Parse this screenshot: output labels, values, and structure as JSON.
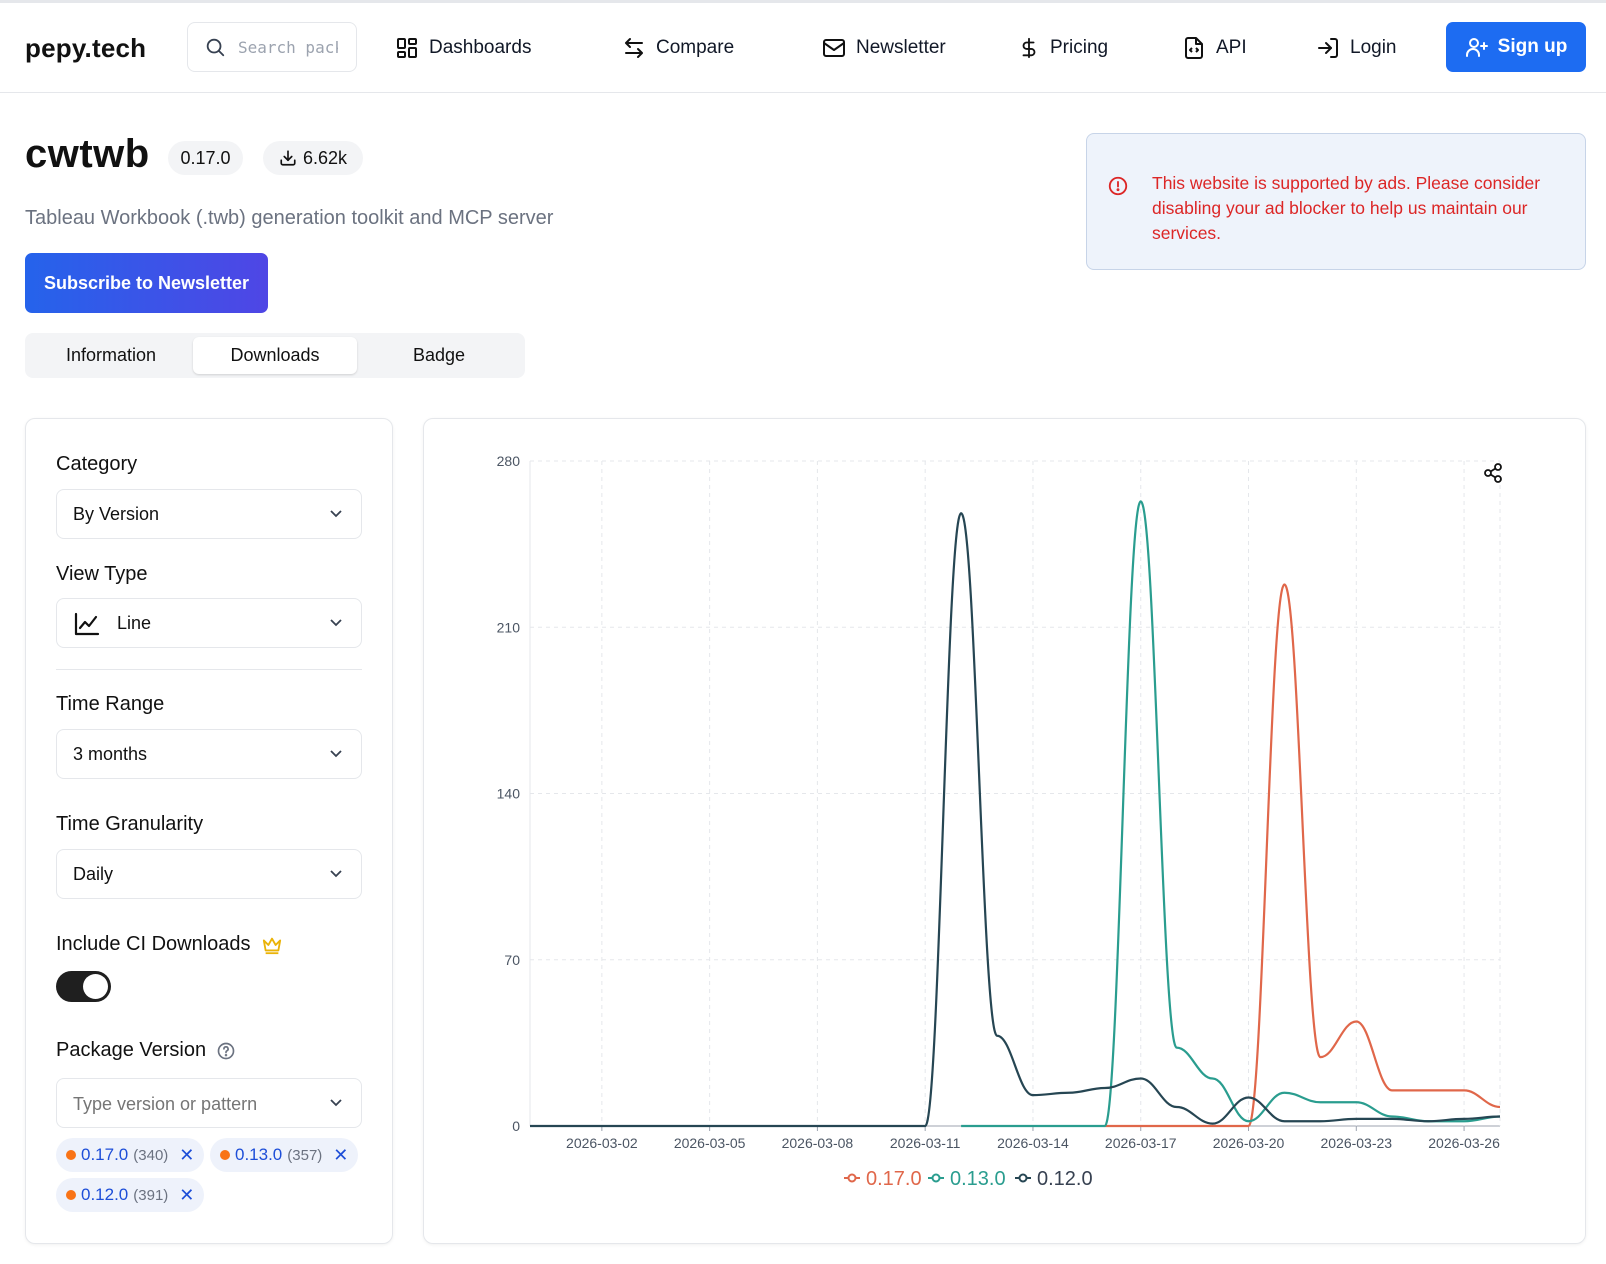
{
  "header": {
    "logo": "pepy.tech",
    "search_placeholder": "Search packages",
    "nav": [
      {
        "label": "Dashboards",
        "icon": "dashboard-icon"
      },
      {
        "label": "Compare",
        "icon": "compare-arrows-icon"
      },
      {
        "label": "Newsletter",
        "icon": "mail-icon"
      },
      {
        "label": "Pricing",
        "icon": "dollar-icon"
      },
      {
        "label": "API",
        "icon": "code-file-icon"
      },
      {
        "label": "Login",
        "icon": "login-icon"
      }
    ],
    "signup_label": "Sign up"
  },
  "package": {
    "name": "cwtwb",
    "version": "0.17.0",
    "downloads": "6.62k",
    "description": "Tableau Workbook (.twb) generation toolkit and MCP server"
  },
  "subscribe_label": "Subscribe to Newsletter",
  "ad_notice": "This website is supported by ads. Please consider disabling your ad blocker to help us maintain our services.",
  "tabs": [
    "Information",
    "Downloads",
    "Badge"
  ],
  "active_tab": "Downloads",
  "sidebar": {
    "category_label": "Category",
    "category_value": "By Version",
    "view_type_label": "View Type",
    "view_type_value": "Line",
    "time_range_label": "Time Range",
    "time_range_value": "3 months",
    "granularity_label": "Time Granularity",
    "granularity_value": "Daily",
    "ci_label": "Include CI Downloads",
    "ci_enabled": true,
    "package_version_label": "Package Version",
    "version_placeholder": "Type version or pattern",
    "selected_versions": [
      {
        "version": "0.17.0",
        "count": "(340)"
      },
      {
        "version": "0.13.0",
        "count": "(357)"
      },
      {
        "version": "0.12.0",
        "count": "(391)"
      }
    ]
  },
  "chart_data": {
    "type": "line",
    "title": "",
    "xlabel": "",
    "ylabel": "",
    "ylim": [
      0,
      280
    ],
    "yticks": [
      0,
      70,
      140,
      210,
      280
    ],
    "xtick_labels": [
      "2026-03-02",
      "2026-03-05",
      "2026-03-08",
      "2026-03-11",
      "2026-03-14",
      "2026-03-17",
      "2026-03-20",
      "2026-03-23",
      "2026-03-26"
    ],
    "x": [
      "2026-02-28",
      "2026-03-01",
      "2026-03-02",
      "2026-03-03",
      "2026-03-04",
      "2026-03-05",
      "2026-03-06",
      "2026-03-07",
      "2026-03-08",
      "2026-03-09",
      "2026-03-10",
      "2026-03-11",
      "2026-03-12",
      "2026-03-13",
      "2026-03-14",
      "2026-03-15",
      "2026-03-16",
      "2026-03-17",
      "2026-03-18",
      "2026-03-19",
      "2026-03-20",
      "2026-03-21",
      "2026-03-22",
      "2026-03-23",
      "2026-03-24",
      "2026-03-25",
      "2026-03-26",
      "2026-03-27"
    ],
    "series": [
      {
        "name": "0.17.0",
        "color": "#e0674a",
        "values": [
          null,
          null,
          null,
          null,
          null,
          null,
          null,
          null,
          null,
          null,
          null,
          null,
          null,
          null,
          null,
          null,
          0,
          0,
          0,
          0,
          0,
          228,
          29,
          44,
          15,
          15,
          15,
          8
        ]
      },
      {
        "name": "0.13.0",
        "color": "#2a9d8f",
        "values": [
          null,
          null,
          null,
          null,
          null,
          null,
          null,
          null,
          null,
          null,
          null,
          null,
          0,
          0,
          0,
          0,
          0,
          263,
          33,
          20,
          2,
          14,
          10,
          10,
          4,
          2,
          2,
          4
        ]
      },
      {
        "name": "0.12.0",
        "color": "#264653",
        "values": [
          0,
          0,
          0,
          0,
          0,
          0,
          0,
          0,
          0,
          0,
          0,
          0,
          258,
          38,
          13,
          14,
          16,
          20,
          8,
          1,
          12,
          2,
          2,
          3,
          3,
          2,
          3,
          4
        ]
      }
    ],
    "legend": "bottom",
    "grid": true
  }
}
